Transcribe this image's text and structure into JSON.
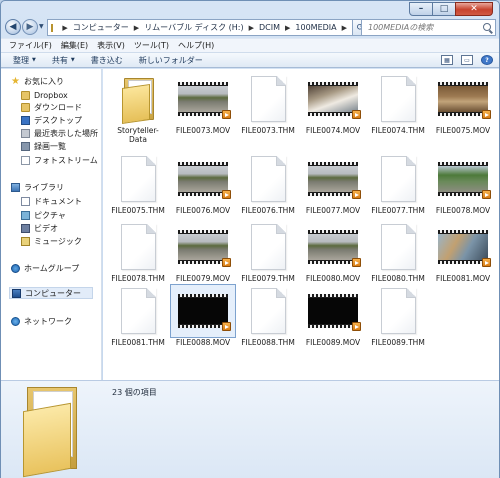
{
  "window": {
    "caption_buttons": {
      "minimize": "–",
      "maximize": "□",
      "close": "✕"
    }
  },
  "address_bar": {
    "crumbs": [
      "コンピューター",
      "リムーバブル ディスク (H:)",
      "DCIM",
      "100MEDIA"
    ],
    "search_placeholder": "100MEDIAの検索"
  },
  "menu": [
    "ファイル(F)",
    "編集(E)",
    "表示(V)",
    "ツール(T)",
    "ヘルプ(H)"
  ],
  "toolbar": {
    "organize": "整理",
    "share": "共有",
    "burn": "書き込む",
    "new_folder": "新しいフォルダー"
  },
  "nav_pane": {
    "favorites": "お気に入り",
    "dropbox": "Dropbox",
    "downloads": "ダウンロード",
    "desktop": "デスクトップ",
    "recent": "最近表示した場所",
    "recordings": "録画一覧",
    "photostream": "フォトストリーム",
    "libraries": "ライブラリ",
    "documents": "ドキュメント",
    "pictures": "ピクチャ",
    "videos": "ビデオ",
    "music": "ミュージック",
    "homegroup": "ホームグループ",
    "computer": "コンピューター",
    "network": "ネットワーク"
  },
  "files": [
    {
      "name": "Storyteller-Data",
      "kind": "folder"
    },
    {
      "name": "FILE0073.MOV",
      "kind": "video",
      "frame": "road"
    },
    {
      "name": "FILE0073.THM",
      "kind": "thm"
    },
    {
      "name": "FILE0074.MOV",
      "kind": "video",
      "frame": "interior"
    },
    {
      "name": "FILE0074.THM",
      "kind": "thm"
    },
    {
      "name": "FILE0075.MOV",
      "kind": "video",
      "frame": "wood"
    },
    {
      "name": "FILE0075.THM",
      "kind": "thm"
    },
    {
      "name": "FILE0076.MOV",
      "kind": "video",
      "frame": "road"
    },
    {
      "name": "FILE0076.THM",
      "kind": "thm"
    },
    {
      "name": "FILE0077.MOV",
      "kind": "video",
      "frame": "road"
    },
    {
      "name": "FILE0077.THM",
      "kind": "thm"
    },
    {
      "name": "FILE0078.MOV",
      "kind": "video",
      "frame": "green"
    },
    {
      "name": "FILE0078.THM",
      "kind": "thm"
    },
    {
      "name": "FILE0079.MOV",
      "kind": "video",
      "frame": "road"
    },
    {
      "name": "FILE0079.THM",
      "kind": "thm"
    },
    {
      "name": "FILE0080.MOV",
      "kind": "video",
      "frame": "road"
    },
    {
      "name": "FILE0080.THM",
      "kind": "thm"
    },
    {
      "name": "FILE0081.MOV",
      "kind": "video",
      "frame": "blue"
    },
    {
      "name": "FILE0081.THM",
      "kind": "thm"
    },
    {
      "name": "FILE0088.MOV",
      "kind": "video",
      "frame": "dark",
      "selected": true
    },
    {
      "name": "FILE0088.THM",
      "kind": "thm"
    },
    {
      "name": "FILE0089.MOV",
      "kind": "video",
      "frame": "dark"
    },
    {
      "name": "FILE0089.THM",
      "kind": "thm"
    }
  ],
  "details": {
    "item_count": "23 個の項目"
  }
}
